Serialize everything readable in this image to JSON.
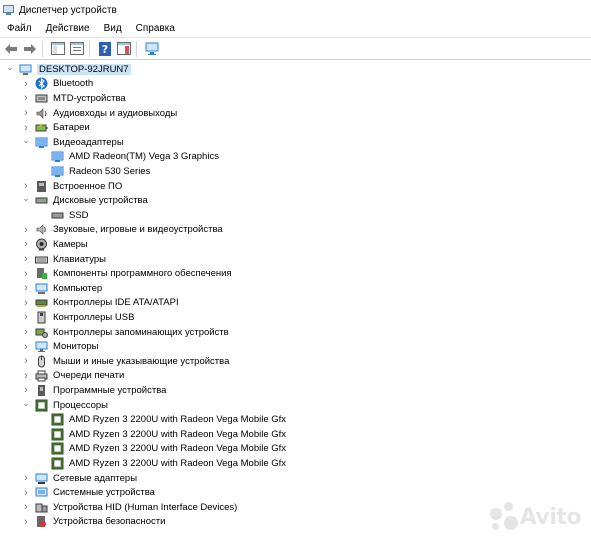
{
  "window": {
    "title": "Диспетчер устройств"
  },
  "menu": [
    "Файл",
    "Действие",
    "Вид",
    "Справка"
  ],
  "tree": [
    {
      "label": "DESKTOP-92JRUN7",
      "level": 0,
      "state": "expanded",
      "icon": "computer-root-icon"
    },
    {
      "label": "Bluetooth",
      "level": 1,
      "state": "collapsed",
      "icon": "bluetooth-icon"
    },
    {
      "label": "MTD-устройства",
      "level": 1,
      "state": "collapsed",
      "icon": "mtd-device-icon"
    },
    {
      "label": "Аудиовходы и аудиовыходы",
      "level": 1,
      "state": "collapsed",
      "icon": "audio-icon"
    },
    {
      "label": "Батареи",
      "level": 1,
      "state": "collapsed",
      "icon": "battery-icon"
    },
    {
      "label": "Видеоадаптеры",
      "level": 1,
      "state": "expanded",
      "icon": "display-adapter-icon"
    },
    {
      "label": "AMD Radeon(TM) Vega 3 Graphics",
      "level": 2,
      "state": "leaf",
      "icon": "display-adapter-icon"
    },
    {
      "label": "Radeon 530 Series",
      "level": 2,
      "state": "leaf",
      "icon": "display-adapter-icon"
    },
    {
      "label": "Встроенное ПО",
      "level": 1,
      "state": "collapsed",
      "icon": "firmware-icon"
    },
    {
      "label": "Дисковые устройства",
      "level": 1,
      "state": "expanded",
      "icon": "disk-drive-icon"
    },
    {
      "label": "SSD",
      "level": 2,
      "state": "leaf",
      "icon": "disk-drive-icon"
    },
    {
      "label": "Звуковые, игровые и видеоустройства",
      "level": 1,
      "state": "collapsed",
      "icon": "sound-icon"
    },
    {
      "label": "Камеры",
      "level": 1,
      "state": "collapsed",
      "icon": "camera-icon"
    },
    {
      "label": "Клавиатуры",
      "level": 1,
      "state": "collapsed",
      "icon": "keyboard-icon"
    },
    {
      "label": "Компоненты программного обеспечения",
      "level": 1,
      "state": "collapsed",
      "icon": "software-component-icon"
    },
    {
      "label": "Компьютер",
      "level": 1,
      "state": "collapsed",
      "icon": "computer-icon"
    },
    {
      "label": "Контроллеры IDE ATA/ATAPI",
      "level": 1,
      "state": "collapsed",
      "icon": "ide-controller-icon"
    },
    {
      "label": "Контроллеры USB",
      "level": 1,
      "state": "collapsed",
      "icon": "usb-icon"
    },
    {
      "label": "Контроллеры запоминающих устройств",
      "level": 1,
      "state": "collapsed",
      "icon": "storage-controller-icon"
    },
    {
      "label": "Мониторы",
      "level": 1,
      "state": "collapsed",
      "icon": "monitor-icon"
    },
    {
      "label": "Мыши и иные указывающие устройства",
      "level": 1,
      "state": "collapsed",
      "icon": "mouse-icon"
    },
    {
      "label": "Очереди печати",
      "level": 1,
      "state": "collapsed",
      "icon": "print-queue-icon"
    },
    {
      "label": "Программные устройства",
      "level": 1,
      "state": "collapsed",
      "icon": "software-device-icon"
    },
    {
      "label": "Процессоры",
      "level": 1,
      "state": "expanded",
      "icon": "processor-icon"
    },
    {
      "label": "AMD Ryzen 3 2200U with Radeon Vega Mobile Gfx",
      "level": 2,
      "state": "leaf",
      "icon": "processor-icon"
    },
    {
      "label": "AMD Ryzen 3 2200U with Radeon Vega Mobile Gfx",
      "level": 2,
      "state": "leaf",
      "icon": "processor-icon"
    },
    {
      "label": "AMD Ryzen 3 2200U with Radeon Vega Mobile Gfx",
      "level": 2,
      "state": "leaf",
      "icon": "processor-icon"
    },
    {
      "label": "AMD Ryzen 3 2200U with Radeon Vega Mobile Gfx",
      "level": 2,
      "state": "leaf",
      "icon": "processor-icon"
    },
    {
      "label": "Сетевые адаптеры",
      "level": 1,
      "state": "collapsed",
      "icon": "network-adapter-icon"
    },
    {
      "label": "Системные устройства",
      "level": 1,
      "state": "collapsed",
      "icon": "system-device-icon"
    },
    {
      "label": "Устройства HID (Human Interface Devices)",
      "level": 1,
      "state": "collapsed",
      "icon": "hid-icon"
    },
    {
      "label": "Устройства безопасности",
      "level": 1,
      "state": "collapsed",
      "icon": "security-device-icon"
    }
  ],
  "watermark": {
    "text": "Avito"
  },
  "colors": {
    "selection": "#cce4f7",
    "icon_blue": "#2f7fd6",
    "chevron": "#777777"
  }
}
